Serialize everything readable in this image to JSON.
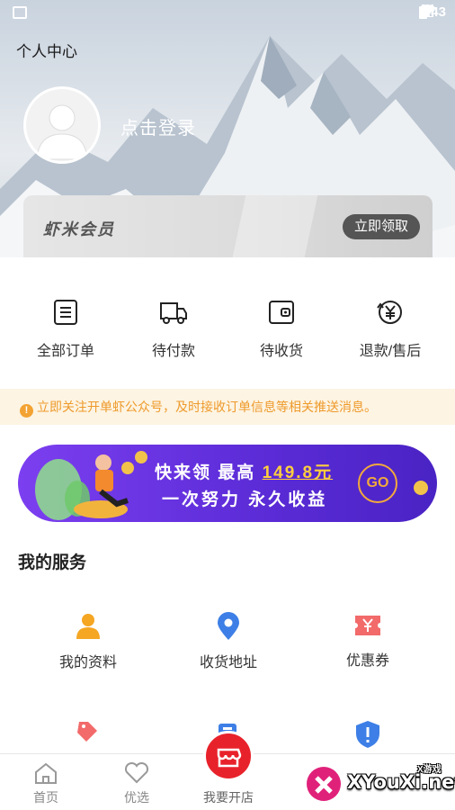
{
  "status_bar": {
    "time": "4:43"
  },
  "header": {
    "title": "个人中心",
    "login_prompt": "点击登录"
  },
  "vip": {
    "title": "虾米会员",
    "button": "立即领取"
  },
  "orders": [
    {
      "label": "全部订单",
      "icon": "order-list-icon"
    },
    {
      "label": "待付款",
      "icon": "truck-icon"
    },
    {
      "label": "待收货",
      "icon": "wallet-icon"
    },
    {
      "label": "退款/售后",
      "icon": "refund-yen-icon"
    }
  ],
  "notice": {
    "text": "立即关注开单虾公众号，及时接收订单信息等相关推送消息。"
  },
  "banner": {
    "line1_prefix": "快来领 最高",
    "amount": "149.8元",
    "line2": "一次努力 永久收益",
    "go": "GO"
  },
  "services": {
    "title": "我的服务",
    "items": [
      {
        "label": "我的资料",
        "icon": "user-profile-icon"
      },
      {
        "label": "收货地址",
        "icon": "location-pin-icon"
      },
      {
        "label": "优惠券",
        "icon": "coupon-icon"
      }
    ]
  },
  "tabbar": {
    "items": [
      {
        "label": "首页",
        "icon": "home-icon"
      },
      {
        "label": "优选",
        "icon": "heart-icon"
      },
      {
        "label": "我要开店",
        "icon": "shop-icon"
      }
    ]
  },
  "watermark": {
    "text": "XYouXi.net",
    "small": "X游戏"
  },
  "colors": {
    "accent_red": "#e8222b",
    "banner_purple": "#5a2bd6",
    "notice_orange": "#ee9a2b"
  }
}
